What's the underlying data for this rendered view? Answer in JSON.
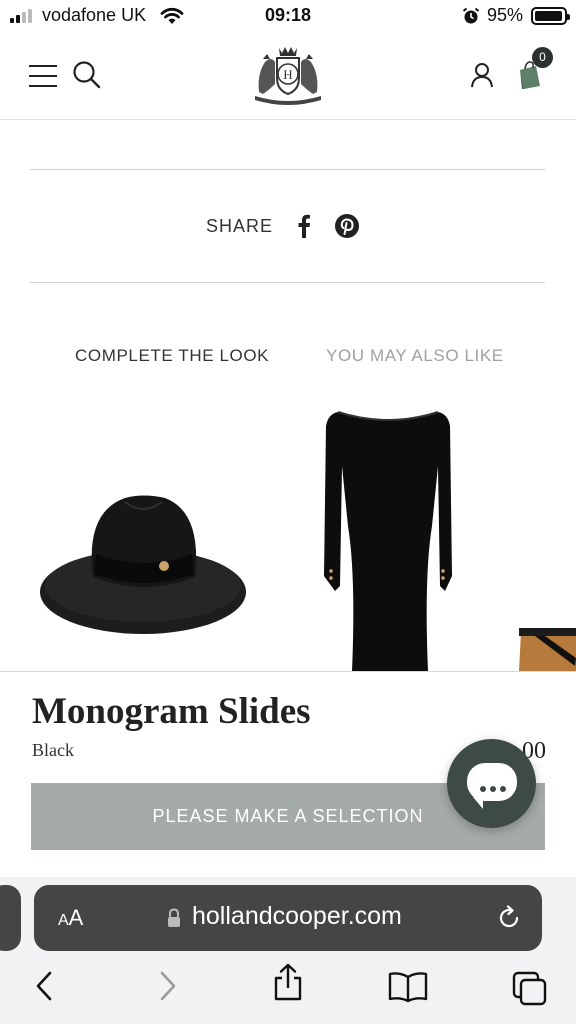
{
  "status_bar": {
    "carrier": "vodafone UK",
    "time": "09:18",
    "battery_percent": "95%",
    "battery_level": 0.95,
    "icons": [
      "signal-icon",
      "wifi-icon",
      "alarm-icon",
      "battery-icon"
    ]
  },
  "header": {
    "icons": [
      "menu-icon",
      "search-icon",
      "brand-crest-logo",
      "account-icon",
      "shopping-bag-icon"
    ],
    "cart_count": "0",
    "cart_badge_color": "#2c3230"
  },
  "share": {
    "label": "SHARE",
    "icons": [
      "facebook-icon",
      "pinterest-icon"
    ]
  },
  "tabs": [
    {
      "label": "COMPLETE THE LOOK",
      "active": true
    },
    {
      "label": "YOU MAY ALSO LIKE",
      "active": false
    }
  ],
  "product_images": [
    "black-fedora-hat",
    "black-long-sleeve-dress",
    "tan-slide-partial"
  ],
  "product": {
    "name": "Monogram Slides",
    "color": "Black",
    "price_partial": "00",
    "cta": "PLEASE MAKE A SELECTION",
    "cta_color": "#a5aba8"
  },
  "chat": {
    "icon": "chat-icon",
    "color": "#3d4a45"
  },
  "browser": {
    "text_size_label": {
      "small": "A",
      "large": "A"
    },
    "url": "hollandcooper.com",
    "icons": [
      "lock-icon",
      "reload-icon",
      "back-icon",
      "forward-icon",
      "share-icon",
      "bookmarks-icon",
      "tabs-icon"
    ]
  }
}
